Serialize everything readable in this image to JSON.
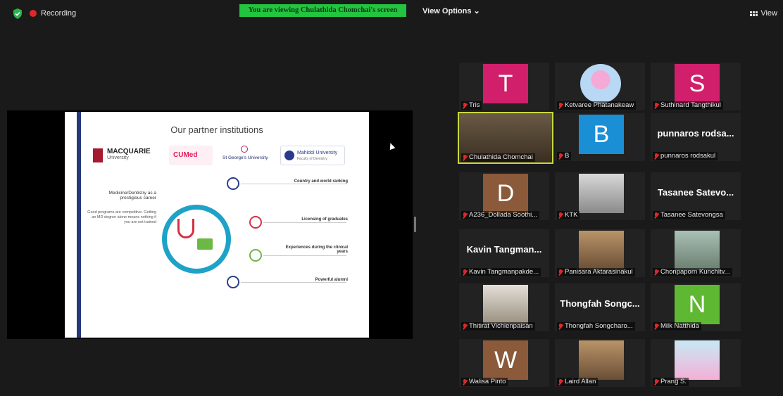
{
  "topbar": {
    "recording_label": "Recording",
    "viewing_banner": "You are viewing Chulathida Chomchai's screen",
    "view_options_label": "View Options",
    "view_label": "View"
  },
  "slide": {
    "title": "Our partner institutions",
    "logos": {
      "macquarie_name": "MACQUARIE",
      "macquarie_sub": "University",
      "cumed": "CUMed",
      "st_georges": "St George's University",
      "mahidol": "Mahidol University",
      "mahidol_sub": "Faculty of Dentistry"
    },
    "left_heading": "Medicine/Dentistry as a prestigious career",
    "left_body": "Good programs are competitive. Getting an MD degree alone means nothing if you are not trained",
    "features": [
      {
        "heading": "Country and world ranking"
      },
      {
        "heading": "Licensing of graduates"
      },
      {
        "heading": "Experiences during the clinical years"
      },
      {
        "heading": "Powerful alumni"
      }
    ]
  },
  "gallery": {
    "tiles": [
      {
        "name": "Tris",
        "letter": "T",
        "color": "#d11f6b"
      },
      {
        "name": "Ketvaree Phatanakeaw",
        "photo": "pink-avatar"
      },
      {
        "name": "Suthinard Tangthikul",
        "letter": "S",
        "color": "#d11f6b"
      },
      {
        "name": "Chulathida Chomchai",
        "photo": "camera-video",
        "active": true
      },
      {
        "name": "B",
        "letter": "B",
        "color": "#1a8fd6"
      },
      {
        "name": "punnaros rodsakul",
        "display_name": "punnaros rodsa..."
      },
      {
        "name": "A236_Dollada Soothi...",
        "letter": "D",
        "color": "#8a5a3a"
      },
      {
        "name": "KTK",
        "photo": "selfie"
      },
      {
        "name": "Tasanee Satevongsa",
        "display_name": "Tasanee Satevo..."
      },
      {
        "name": "Kavin Tangmanpakde...",
        "display_name": "Kavin Tangman..."
      },
      {
        "name": "Panisara Aktarasinakul",
        "photo": "portrait"
      },
      {
        "name": "Chonpaporn Kunchitv...",
        "photo": "portrait"
      },
      {
        "name": "Thitirat Vichienpaisan",
        "photo": "cat"
      },
      {
        "name": "Thongfah Songcharo...",
        "display_name": "Thongfah Songc..."
      },
      {
        "name": "Milk Natthida",
        "letter": "N",
        "color": "#5fb832"
      },
      {
        "name": "Walisa Pinto",
        "letter": "W",
        "color": "#8a5a3a"
      },
      {
        "name": "Laird Allan",
        "photo": "portrait"
      },
      {
        "name": "Prang S.",
        "photo": "cartoon"
      }
    ]
  },
  "colors": {
    "banner_green": "#23c43f",
    "active_speaker_border": "#c7d93d",
    "recording_red": "#e02828"
  }
}
